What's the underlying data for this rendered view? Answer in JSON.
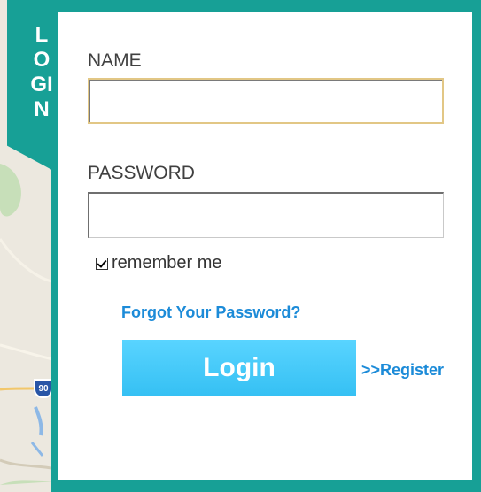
{
  "tab": {
    "label": "LOGIN"
  },
  "form": {
    "name_label": "NAME",
    "name_value": "",
    "password_label": "PASSWORD",
    "password_value": "",
    "remember_label": "remember me",
    "remember_checked": true,
    "forgot_label": "Forgot Your Password?",
    "login_label": "Login",
    "register_label": ">>Register"
  },
  "map": {
    "highway_shield": "90"
  },
  "colors": {
    "frame": "#17a096",
    "link": "#1c8bd8",
    "button": "#42c8f7",
    "button_text": "#ffffff",
    "name_focus_border": "#e2c785"
  }
}
